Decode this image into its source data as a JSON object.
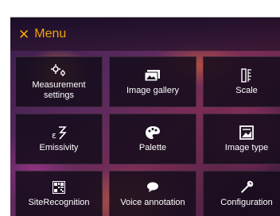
{
  "header": {
    "close_icon": "close-icon",
    "title": "Menu"
  },
  "colors": {
    "accent": "#f2a20c",
    "tile_background": "#16101c",
    "text": "#ffffff"
  },
  "tiles": [
    {
      "label": "Measurement settings",
      "icon": "measurement-settings-icon"
    },
    {
      "label": "Image gallery",
      "icon": "image-gallery-icon"
    },
    {
      "label": "Scale",
      "icon": "scale-icon"
    },
    {
      "label": "Emissivity",
      "icon": "emissivity-icon"
    },
    {
      "label": "Palette",
      "icon": "palette-icon"
    },
    {
      "label": "Image type",
      "icon": "image-type-icon"
    },
    {
      "label": "SiteRecognition",
      "icon": "qr-code-icon"
    },
    {
      "label": "Voice annotation",
      "icon": "speech-bubble-icon"
    },
    {
      "label": "Configuration",
      "icon": "wrench-icon"
    }
  ]
}
